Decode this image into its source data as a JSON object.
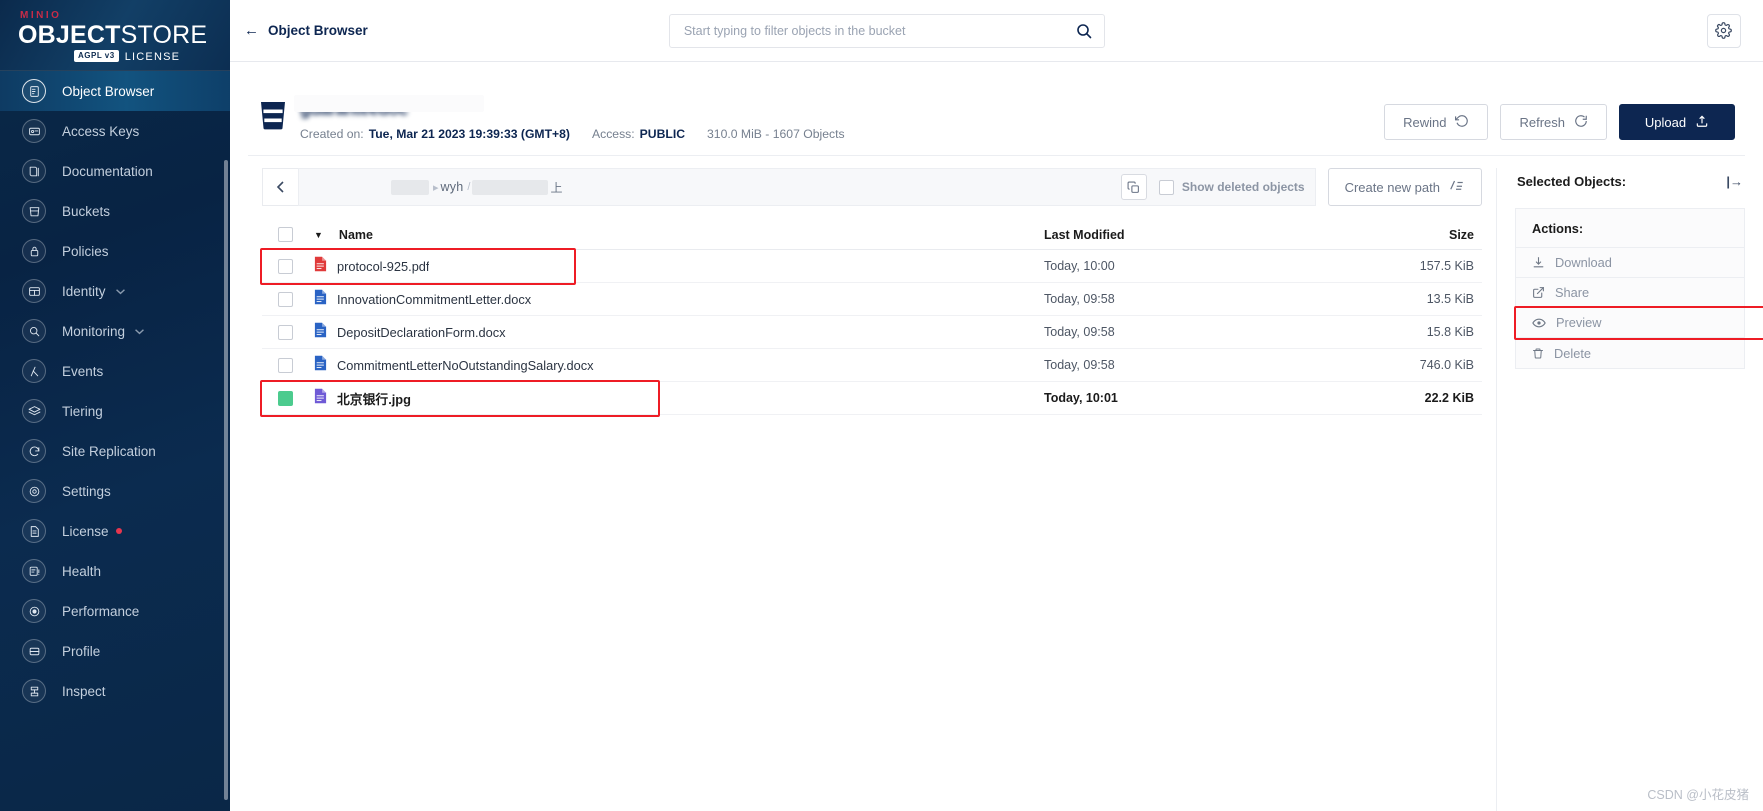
{
  "brand": {
    "minio": "MINIO",
    "object": "OBJECT",
    "store": "STORE",
    "badge": "AGPL v3",
    "license": "LICENSE"
  },
  "sidebar": {
    "items": [
      {
        "label": "Object Browser",
        "icon": "object-browser-icon",
        "active": true,
        "caret": false,
        "dot": false
      },
      {
        "label": "Access Keys",
        "icon": "access-keys-icon",
        "active": false,
        "caret": false,
        "dot": false
      },
      {
        "label": "Documentation",
        "icon": "documentation-icon",
        "active": false,
        "caret": false,
        "dot": false
      },
      {
        "label": "Buckets",
        "icon": "buckets-icon",
        "active": false,
        "caret": false,
        "dot": false
      },
      {
        "label": "Policies",
        "icon": "policies-icon",
        "active": false,
        "caret": false,
        "dot": false
      },
      {
        "label": "Identity",
        "icon": "identity-icon",
        "active": false,
        "caret": true,
        "dot": false
      },
      {
        "label": "Monitoring",
        "icon": "monitoring-icon",
        "active": false,
        "caret": true,
        "dot": false
      },
      {
        "label": "Events",
        "icon": "events-icon",
        "active": false,
        "caret": false,
        "dot": false
      },
      {
        "label": "Tiering",
        "icon": "tiering-icon",
        "active": false,
        "caret": false,
        "dot": false
      },
      {
        "label": "Site Replication",
        "icon": "site-replication-icon",
        "active": false,
        "caret": false,
        "dot": false
      },
      {
        "label": "Settings",
        "icon": "settings-icon",
        "active": false,
        "caret": false,
        "dot": false
      },
      {
        "label": "License",
        "icon": "license-icon",
        "active": false,
        "caret": false,
        "dot": true
      },
      {
        "label": "Health",
        "icon": "health-icon",
        "active": false,
        "caret": false,
        "dot": false
      },
      {
        "label": "Performance",
        "icon": "performance-icon",
        "active": false,
        "caret": false,
        "dot": false
      },
      {
        "label": "Profile",
        "icon": "profile-icon",
        "active": false,
        "caret": false,
        "dot": false
      },
      {
        "label": "Inspect",
        "icon": "inspect-icon",
        "active": false,
        "caret": false,
        "dot": false
      }
    ]
  },
  "topbar": {
    "back_arrow": "←",
    "title": "Object Browser",
    "search_placeholder": "Start typing to filter objects in the bucket",
    "search_value": ""
  },
  "bucket": {
    "name_redacted": "guaranteedoc",
    "created_label": "Created on:",
    "created_value": "Tue, Mar 21 2023 19:39:33 (GMT+8)",
    "access_label": "Access:",
    "access_value": "PUBLIC",
    "size_objects": "310.0 MiB - 1607 Objects",
    "separator": "-",
    "buttons": {
      "rewind": "Rewind",
      "refresh": "Refresh",
      "upload": "Upload"
    }
  },
  "path": {
    "crumb_visible": "wyh",
    "crumb_tail": "上",
    "show_deleted_label": "Show deleted objects",
    "show_deleted_checked": false,
    "create_new_path": "Create new path"
  },
  "table": {
    "columns": {
      "name": "Name",
      "last_modified": "Last Modified",
      "size": "Size"
    },
    "rows": [
      {
        "name": "protocol-925.pdf",
        "type": "pdf",
        "modified": "Today, 10:00",
        "size": "157.5 KiB",
        "selected": false,
        "highlighted": true
      },
      {
        "name": "InnovationCommitmentLetter.docx",
        "type": "docx",
        "modified": "Today, 09:58",
        "size": "13.5 KiB",
        "selected": false,
        "highlighted": false
      },
      {
        "name": "DepositDeclarationForm.docx",
        "type": "docx",
        "modified": "Today, 09:58",
        "size": "15.8 KiB",
        "selected": false,
        "highlighted": false
      },
      {
        "name": "CommitmentLetterNoOutstandingSalary.docx",
        "type": "docx",
        "modified": "Today, 09:58",
        "size": "746.0 KiB",
        "selected": false,
        "highlighted": false
      },
      {
        "name": "北京银行.jpg",
        "type": "jpg",
        "modified": "Today, 10:01",
        "size": "22.2 KiB",
        "selected": true,
        "highlighted": true
      }
    ]
  },
  "selected_panel": {
    "title": "Selected Objects:",
    "collapse_icon": "|→",
    "actions_title": "Actions:",
    "actions": [
      {
        "label": "Download",
        "icon": "download-icon",
        "highlighted": false
      },
      {
        "label": "Share",
        "icon": "share-icon",
        "highlighted": false
      },
      {
        "label": "Preview",
        "icon": "eye-icon",
        "highlighted": true
      },
      {
        "label": "Delete",
        "icon": "trash-icon",
        "highlighted": false
      }
    ]
  },
  "watermark": "CSDN @小花皮猪",
  "colors": {
    "sidebar": "#0a2a48",
    "accent": "#0d2651",
    "highlight": "#ee1c25",
    "selected_check": "#4ccb8e",
    "license_dot": "#e8364e",
    "pdf": "#e03a3a",
    "docx": "#2a63c4",
    "jpg": "#6f5ad6"
  }
}
